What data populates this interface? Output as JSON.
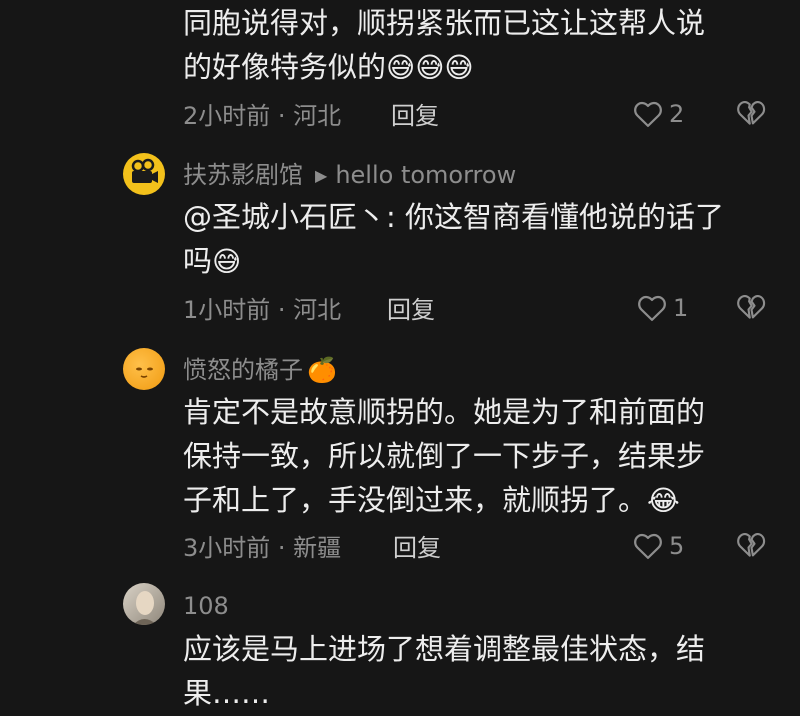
{
  "comments": [
    {
      "text_line1": "同胞说得对，顺拐紧张而已这让这帮人说",
      "text_line2": "的好像特务似的",
      "emoji": "😅😅😅",
      "time": "2小时前 · 河北",
      "reply": "回复",
      "likes": "2"
    },
    {
      "username": "扶苏影剧馆",
      "music": "hello tomorrow",
      "text_line1": "@圣城小石匠丶: 你这智商看懂他说的话了",
      "text_line2": "吗",
      "emoji": "😅",
      "time": "1小时前 · 河北",
      "reply": "回复",
      "likes": "1"
    },
    {
      "username": "愤怒的橘子",
      "username_emoji": "🍊",
      "text_line1": "肯定不是故意顺拐的。她是为了和前面的",
      "text_line2": "保持一致，所以就倒了一下步子，结果步",
      "text_line3": "子和上了，手没倒过来，就顺拐了。",
      "emoji": "😂",
      "time": "3小时前 · 新疆",
      "reply": "回复",
      "likes": "5"
    },
    {
      "username": "108",
      "text_line1": "应该是马上进场了想着调整最佳状态，结",
      "text_line2": "果……"
    }
  ],
  "icons": {
    "like": "heart-outline-icon",
    "dislike": "broken-heart-icon"
  },
  "colors": {
    "background": "#161616",
    "text": "#ededed",
    "secondary": "#8d8d8d"
  }
}
